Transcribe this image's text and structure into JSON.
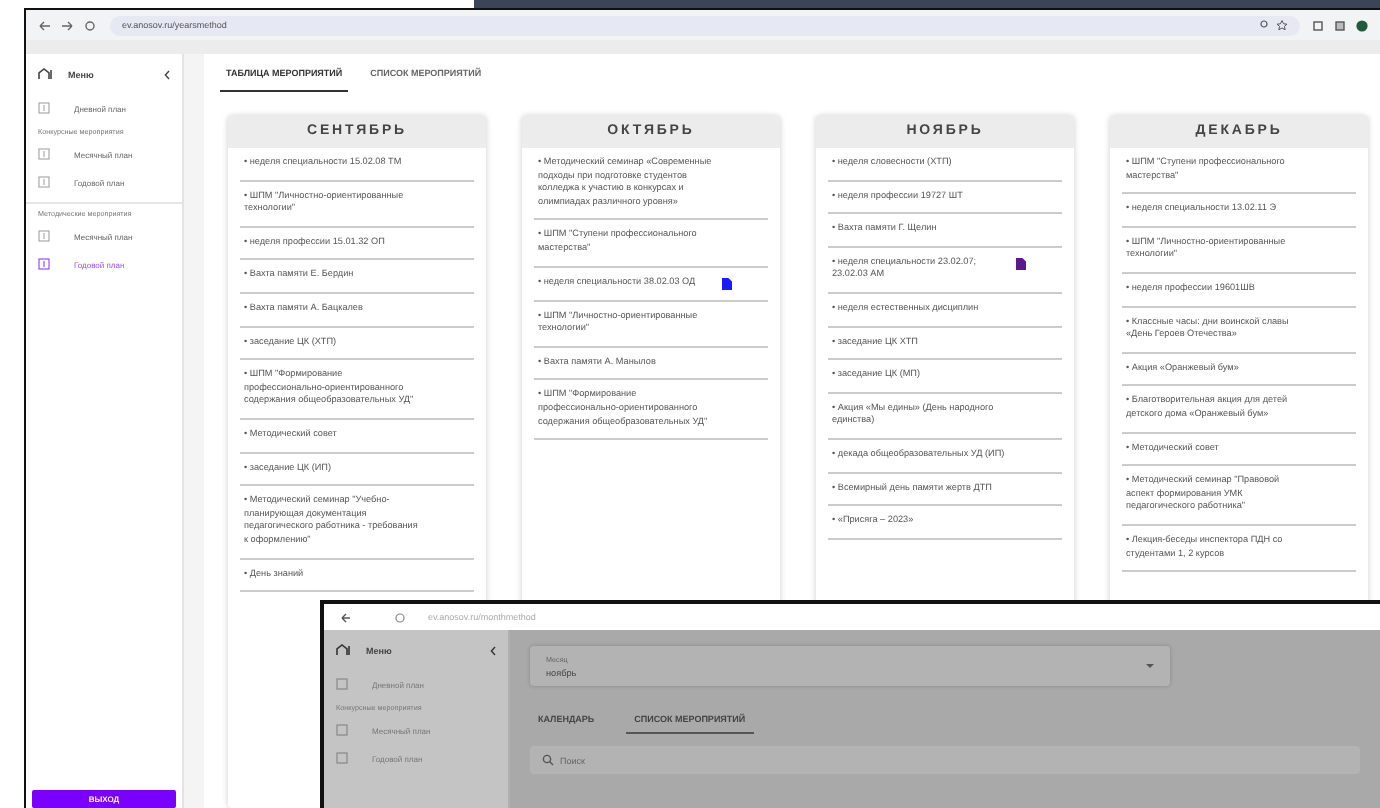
{
  "main_window": {
    "url": "ev.anosov.ru/yearsmethod",
    "sidebar": {
      "title": "Меню",
      "groups": [
        {
          "items": [
            {
              "label": "Дневной план",
              "selected": false
            }
          ]
        },
        {
          "heading": "Конкурсные мероприятия",
          "items": [
            {
              "label": "Месячный план",
              "selected": false
            },
            {
              "label": "Годовой план",
              "selected": false
            }
          ]
        },
        {
          "heading": "Методические мероприятия",
          "items": [
            {
              "label": "Месячный план",
              "selected": false
            },
            {
              "label": "Годовой план",
              "selected": true
            }
          ]
        }
      ],
      "logout": "ВЫХОД"
    },
    "tabs": [
      {
        "label": "ТАБЛИЦА МЕРОПРИЯТИЙ",
        "selected": true
      },
      {
        "label": "СПИСОК МЕРОПРИЯТИЙ",
        "selected": false
      }
    ],
    "months": [
      {
        "title": "СЕНТЯБРЬ",
        "events": [
          {
            "text": "• неделя специальности 15.02.08 ТМ"
          },
          {
            "text": "• ШПМ \"Личностно-ориентированные технологии\""
          },
          {
            "text": "• неделя профессии 15.01.32 ОП"
          },
          {
            "text": "• Вахта памяти Е. Бердин"
          },
          {
            "text": "• Вахта памяти А. Бацкалев"
          },
          {
            "text": "• заседание ЦК (ХТП)"
          },
          {
            "text": "• ШПМ \"Формирование профессионально-ориентированного содержания общеобразовательных УД\""
          },
          {
            "text": "• Методический совет"
          },
          {
            "text": "• заседание ЦК (ИП)"
          },
          {
            "text": "• Методический семинар \"Учебно-планирующая документация педагогического работника - требования к оформлению\""
          },
          {
            "text": "• День знаний"
          }
        ]
      },
      {
        "title": "ОКТЯБРЬ",
        "events": [
          {
            "text": "• Методический семинар «Современные подходы при подготовке студентов колледжа к участию в конкурсах и олимпиадах различного уровня»"
          },
          {
            "text": "• ШПМ \"Ступени профессионального мастерства\""
          },
          {
            "text": "• неделя специальности 38.02.03 ОД",
            "color": "#1a1aff"
          },
          {
            "text": "• ШПМ \"Личностно-ориентированные технологии\""
          },
          {
            "text": "• Вахта памяти А. Манылов"
          },
          {
            "text": "• ШПМ \"Формирование профессионально-ориентированного содержания общеобразовательных УД\""
          }
        ]
      },
      {
        "title": "НОЯБРЬ",
        "events": [
          {
            "text": "• неделя словесности (ХТП)"
          },
          {
            "text": "• неделя профессии 19727 ШТ"
          },
          {
            "text": "• Вахта памяти Г. Щелин"
          },
          {
            "text": "• неделя специальности 23.02.07; 23.02.03 АМ",
            "color": "#5b1a8c"
          },
          {
            "text": "• неделя естественных дисциплин"
          },
          {
            "text": "• заседание ЦК ХТП"
          },
          {
            "text": "• заседание ЦК (МП)"
          },
          {
            "text": "• Акция «Мы едины» (День народного единства)"
          },
          {
            "text": "• декада общеобразовательных УД (ИП)"
          },
          {
            "text": "• Всемирный день памяти жертв ДТП"
          },
          {
            "text": "• «Присяга – 2023»"
          }
        ]
      },
      {
        "title": "ДЕКАБРЬ",
        "events": [
          {
            "text": "• ШПМ \"Ступени профессионального мастерства\""
          },
          {
            "text": "• неделя специальности 13.02.11 Э"
          },
          {
            "text": "• ШПМ \"Личностно-ориентированные технологии\""
          },
          {
            "text": "• неделя профессии 19601ШВ"
          },
          {
            "text": "• Классные часы: дни воинской славы «День Героев Отечества»"
          },
          {
            "text": "• Акция «Оранжевый бум»"
          },
          {
            "text": "• Благотворительная акция для детей детского дома «Оранжевый бум»"
          },
          {
            "text": "• Методический совет"
          },
          {
            "text": "• Методический семинар \"Правовой аспект формирования УМК педагогического работника\""
          },
          {
            "text": "• Лекция-беседы инспектора ПДН со студентами 1, 2 курсов"
          }
        ]
      }
    ]
  },
  "second_window": {
    "url": "ev.anosov.ru/monthmethod",
    "sidebar": {
      "title": "Меню",
      "items": [
        {
          "label": "Дневной план"
        }
      ],
      "heading": "Конкурсные мероприятия",
      "group_items": [
        {
          "label": "Месячный план"
        },
        {
          "label": "Годовой план"
        }
      ]
    },
    "month_select": {
      "label": "Месяц",
      "value": "ноябрь"
    },
    "tabs": [
      {
        "label": "КАЛЕНДАРЬ",
        "selected": false
      },
      {
        "label": "СПИСОК МЕРОПРИЯТИЙ",
        "selected": true
      }
    ],
    "search": {
      "placeholder": "Поиск"
    }
  }
}
